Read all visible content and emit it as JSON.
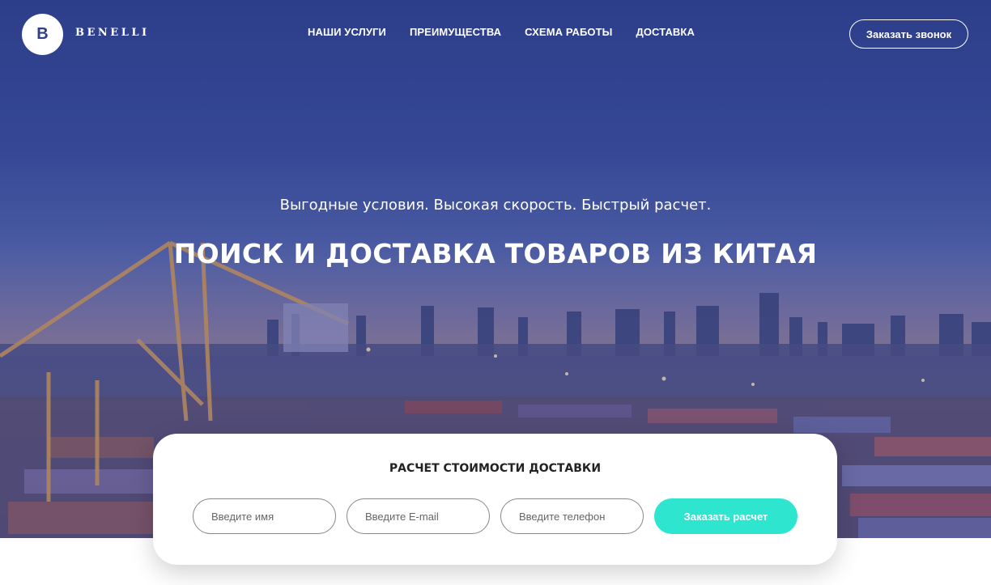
{
  "header": {
    "logo_letter": "B",
    "brand": "BENELLI",
    "nav": [
      "НАШИ УСЛУГИ",
      "ПРЕИМУЩЕСТВА",
      "СХЕМА РАБОТЫ",
      "ДОСТАВКА"
    ],
    "call_button": "Заказать звонок"
  },
  "hero": {
    "subtitle": "Выгодные условия. Высокая скорость. Быстрый расчет.",
    "title": "ПОИСК И ДОСТАВКА ТОВАРОВ ИЗ КИТАЯ"
  },
  "calc": {
    "title": "РАСЧЕТ СТОИМОСТИ ДОСТАВКИ",
    "name_placeholder": "Введите имя",
    "email_placeholder": "Введите E-mail",
    "phone_placeholder": "Введите телефон",
    "submit": "Заказать расчет"
  },
  "colors": {
    "accent": "#2ee6cf",
    "brand_blue": "#2f3f88"
  }
}
